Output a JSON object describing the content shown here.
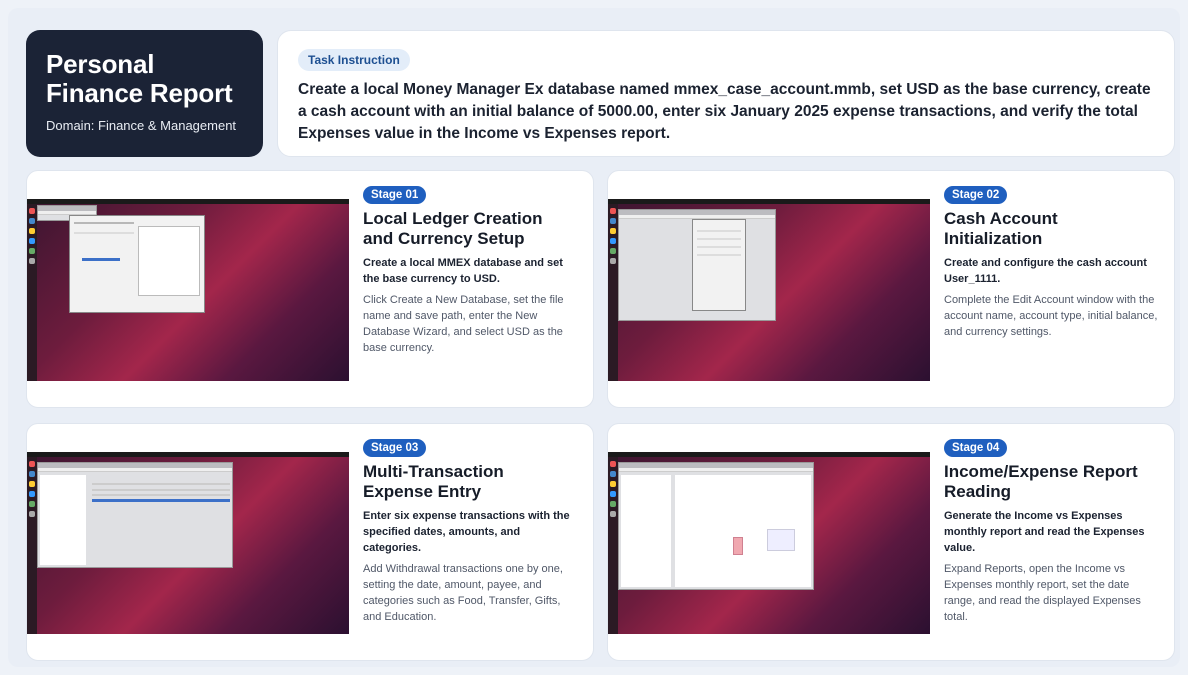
{
  "header": {
    "title": "Personal Finance Report",
    "domain": "Domain: Finance & Management"
  },
  "task": {
    "label": "Task Instruction",
    "text": "Create a local Money Manager Ex database named mmex_case_account.mmb, set USD as the base currency, create a cash account with an initial balance of 5000.00, enter six January 2025 expense transactions, and verify the total Expenses value in the Income vs Expenses report."
  },
  "stages": [
    {
      "badge": "Stage 01",
      "title": "Local Ledger Creation and Currency Setup",
      "subtitle": "Create a local MMEX database and set the base currency to USD.",
      "description": "Click Create a New Database, set the file name and save path, enter the New Database Wizard, and select USD as the base currency."
    },
    {
      "badge": "Stage 02",
      "title": "Cash Account Initialization",
      "subtitle": "Create and configure the cash account User_1111.",
      "description": "Complete the Edit Account window with the account name, account type, initial balance, and currency settings."
    },
    {
      "badge": "Stage 03",
      "title": "Multi-Transaction Expense Entry",
      "subtitle": "Enter six expense transactions with the specified dates, amounts, and categories.",
      "description": "Add Withdrawal transactions one by one, setting the date, amount, payee, and categories such as Food, Transfer, Gifts, and Education."
    },
    {
      "badge": "Stage 04",
      "title": "Income/Expense Report Reading",
      "subtitle": "Generate the Income vs Expenses monthly report and read the Expenses value.",
      "description": "Expand Reports, open the Income vs Expenses monthly report, set the date range, and read the displayed Expenses total."
    }
  ],
  "colors": {
    "title_card_bg": "#1b2336",
    "stage_badge": "#1f5fbf",
    "task_pill_bg": "#e3edf9"
  }
}
